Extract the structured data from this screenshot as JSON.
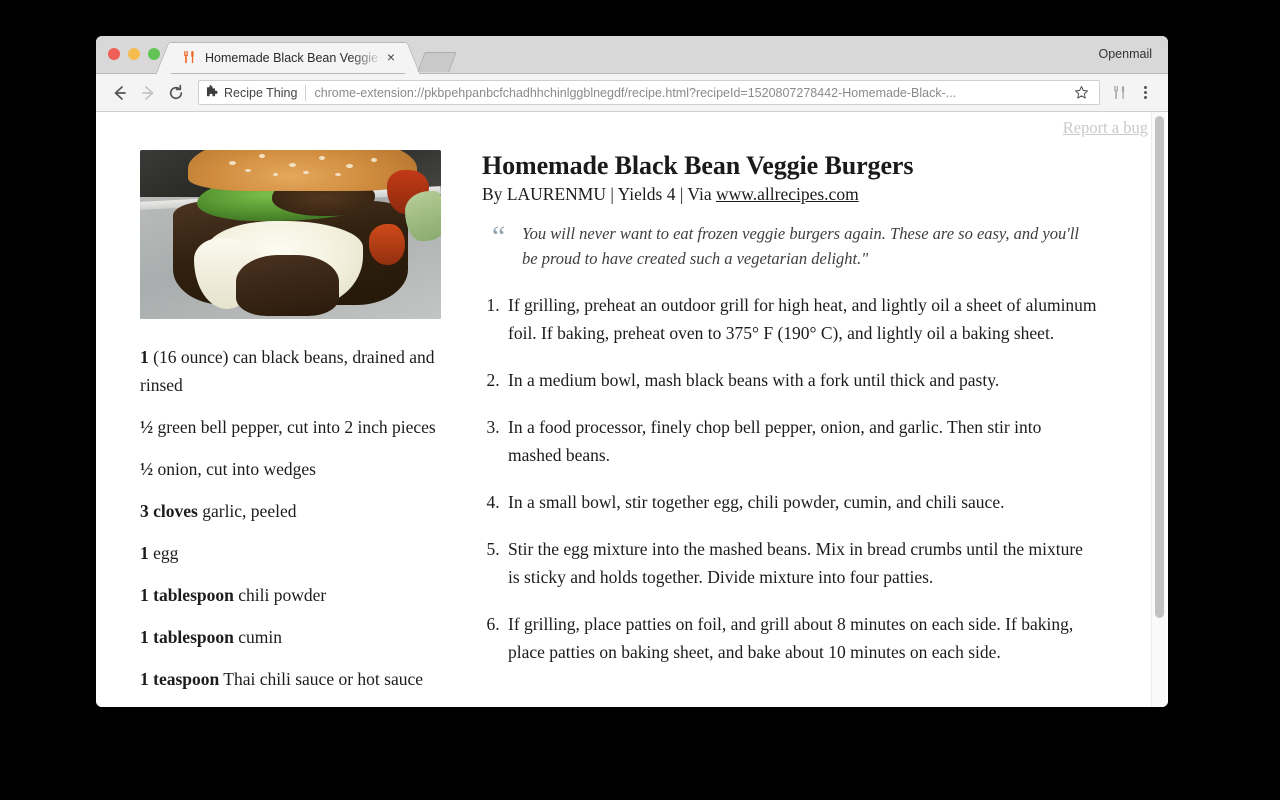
{
  "window": {
    "right_label": "Openmail",
    "traffic_lights": [
      "close",
      "minimize",
      "maximize"
    ]
  },
  "tab": {
    "title": "Homemade Black Bean Veggie Burgers",
    "favicon": "fork-knife-icon",
    "close_label": "×",
    "new_tab_label": ""
  },
  "toolbar": {
    "back_icon": "back-arrow-icon",
    "forward_icon": "forward-arrow-icon",
    "reload_icon": "reload-icon",
    "extension_chip": "Recipe Thing",
    "extension_chip_icon": "puzzle-piece-icon",
    "url": "chrome-extension://pkbpehpanbcfchadhhchinlggblnegdf/recipe.html?recipeId=1520807278442-Homemade-Black-...",
    "star_icon": "star-icon",
    "extension_icon": "fork-knife-icon",
    "menu_icon": "three-dot-menu-icon"
  },
  "page": {
    "report_bug": "Report a bug",
    "photo_alt": "black-bean-veggie-burger-photo",
    "title": "Homemade Black Bean Veggie Burgers",
    "byline_prefix": "By ",
    "author": "LAURENMU",
    "sep1": " | ",
    "yields": "Yields 4",
    "sep2": " | ",
    "via_prefix": "Via ",
    "source_link": "www.allrecipes.com",
    "quote_mark": "“",
    "quote": "You will never want to eat frozen veggie burgers again. These are so easy, and you'll be proud to have created such a vegetarian delight.\"",
    "ingredients": [
      {
        "amount": "1",
        "rest": " (16 ounce) can black beans, drained and rinsed"
      },
      {
        "amount": "½",
        "rest": " green bell pepper, cut into 2 inch pieces"
      },
      {
        "amount": "½",
        "rest": " onion, cut into wedges"
      },
      {
        "amount": "3 cloves",
        "rest": " garlic, peeled"
      },
      {
        "amount": "1",
        "rest": " egg"
      },
      {
        "amount": "1 tablespoon",
        "rest": " chili powder"
      },
      {
        "amount": "1 tablespoon",
        "rest": " cumin"
      },
      {
        "amount": "1 teaspoon",
        "rest": " Thai chili sauce or hot sauce"
      }
    ],
    "directions": [
      "If grilling, preheat an outdoor grill for high heat, and lightly oil a sheet of aluminum foil. If baking, preheat oven to 375° F (190° C), and lightly oil a baking sheet.",
      "In a medium bowl, mash black beans with a fork until thick and pasty.",
      "In a food processor, finely chop bell pepper, onion, and garlic. Then stir into mashed beans.",
      "In a small bowl, stir together egg, chili powder, cumin, and chili sauce.",
      "Stir the egg mixture into the mashed beans. Mix in bread crumbs until the mixture is sticky and holds together. Divide mixture into four patties.",
      "If grilling, place patties on foil, and grill about 8 minutes on each side. If baking, place patties on baking sheet, and bake about 10 minutes on each side."
    ]
  },
  "colors": {
    "favicon_orange": "#ee6a2b",
    "traffic_red": "#ee5f56",
    "traffic_yellow": "#f5bd4f",
    "traffic_green": "#61c454",
    "quote_mark": "#93a4b0",
    "report_bug": "#c9c9c9"
  }
}
